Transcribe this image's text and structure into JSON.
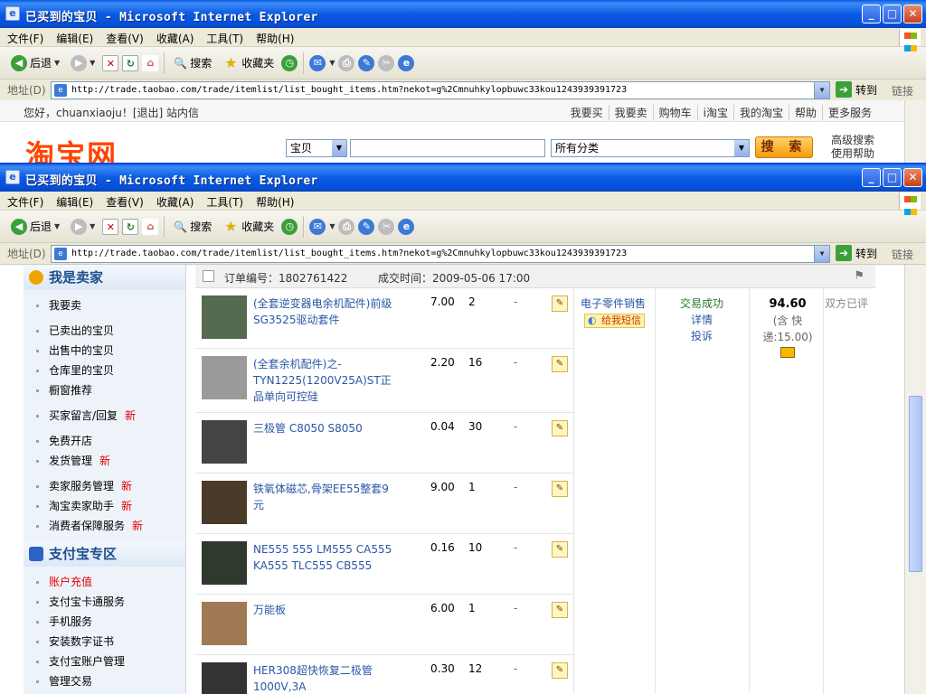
{
  "window": {
    "title": "已买到的宝贝 - Microsoft Internet Explorer",
    "min_glyph": "_",
    "max_glyph": "□",
    "close_glyph": "✕"
  },
  "menu": [
    "文件(F)",
    "编辑(E)",
    "查看(V)",
    "收藏(A)",
    "工具(T)",
    "帮助(H)"
  ],
  "toolbar": {
    "back": "后退",
    "search": "搜索",
    "favorites": "收藏夹"
  },
  "address": {
    "label": "地址(D)",
    "url": "http://trade.taobao.com/trade/itemlist/list_bought_items.htm?nekot=g%2Cmnuhkylopbuwc33kou1243939391723",
    "go": "转到",
    "links": "链接"
  },
  "taobao_nav": {
    "greeting": "您好，chuanxiaoju！[退出]  站内信",
    "links": [
      "我要买",
      "我要卖",
      "购物车",
      "i淘宝",
      "我的淘宝",
      "帮助",
      "更多服务"
    ]
  },
  "search": {
    "logo": "淘宝网",
    "category": "宝贝",
    "all_categories": "所有分类",
    "button": "搜 索",
    "advanced": "高级搜索",
    "help": "使用帮助"
  },
  "sidebar": {
    "seller_heading": "我是卖家",
    "seller_items": [
      {
        "label": "我要卖",
        "new": ""
      },
      {
        "label": "已卖出的宝贝",
        "new": ""
      },
      {
        "label": "出售中的宝贝",
        "new": ""
      },
      {
        "label": "仓库里的宝贝",
        "new": ""
      },
      {
        "label": "橱窗推荐",
        "new": ""
      },
      {
        "label": "买家留言/回复",
        "new": "新"
      },
      {
        "label": "免费开店",
        "new": ""
      },
      {
        "label": "发货管理",
        "new": "新"
      },
      {
        "label": "卖家服务管理",
        "new": "新"
      },
      {
        "label": "淘宝卖家助手",
        "new": "新"
      },
      {
        "label": "消费者保障服务",
        "new": "新"
      }
    ],
    "alipay_heading": "支付宝专区",
    "alipay_items": [
      "账户充值",
      "支付宝卡通服务",
      "手机服务",
      "安装数字证书",
      "支付宝账户管理",
      "管理交易"
    ]
  },
  "order": {
    "number": "订单编号：1802761422",
    "time": "成交时间：2009-05-06 17:00",
    "seller": "电子零件销售",
    "message_button": "给我短信",
    "status": "交易成功",
    "details": "详情",
    "complaint": "投诉",
    "total": "94.60",
    "shipping_line1": "(含 快",
    "shipping_line2": "递:15.00)",
    "rating": "双方已评",
    "items": [
      {
        "name": "(全套逆变器电余机配件)前级SG3525驱动套件",
        "price": "7.00",
        "qty": "2",
        "dash": "-"
      },
      {
        "name": "(全套余机配件)之-TYN1225(1200V25A)ST正品单向可控硅",
        "price": "2.20",
        "qty": "16",
        "dash": "-"
      },
      {
        "name": "三极管 C8050 S8050",
        "price": "0.04",
        "qty": "30",
        "dash": "-"
      },
      {
        "name": "铁氧体磁芯,骨架EE55整套9元",
        "price": "9.00",
        "qty": "1",
        "dash": "-"
      },
      {
        "name": "NE555 555 LM555 CA555 KA555 TLC555 CB555",
        "price": "0.16",
        "qty": "10",
        "dash": "-"
      },
      {
        "name": "万能板",
        "price": "6.00",
        "qty": "1",
        "dash": "-"
      },
      {
        "name": "HER308超快恢复二极管1000V,3A",
        "price": "0.30",
        "qty": "12",
        "dash": "-"
      }
    ]
  }
}
